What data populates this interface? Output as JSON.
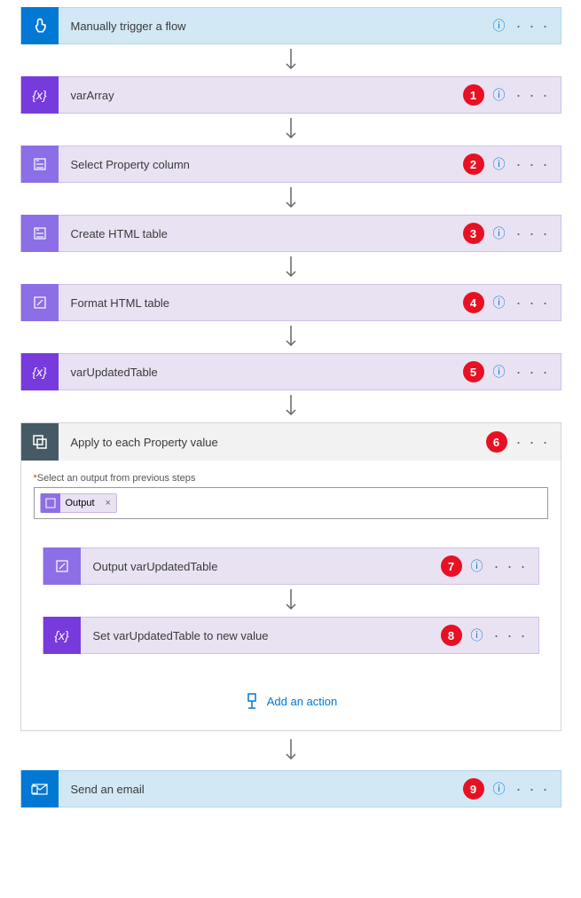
{
  "steps": {
    "trigger": {
      "label": "Manually trigger a flow"
    },
    "s1": {
      "label": "varArray",
      "badge": "1"
    },
    "s2": {
      "label": "Select Property column",
      "badge": "2"
    },
    "s3": {
      "label": "Create HTML table",
      "badge": "3"
    },
    "s4": {
      "label": "Format HTML table",
      "badge": "4"
    },
    "s5": {
      "label": "varUpdatedTable",
      "badge": "5"
    },
    "s6": {
      "label": "Apply to each Property value",
      "badge": "6"
    },
    "s7": {
      "label": "Output varUpdatedTable",
      "badge": "7"
    },
    "s8": {
      "label": "Set varUpdatedTable to new value",
      "badge": "8"
    },
    "s9": {
      "label": "Send an email",
      "badge": "9"
    }
  },
  "inner": {
    "outputLabelReq": "*",
    "outputLabel": "Select an output from previous steps",
    "tokenText": "Output",
    "tokenClose": "×"
  },
  "addAction": "Add an action",
  "helpGlyph": "?",
  "moreGlyph": "· · ·"
}
